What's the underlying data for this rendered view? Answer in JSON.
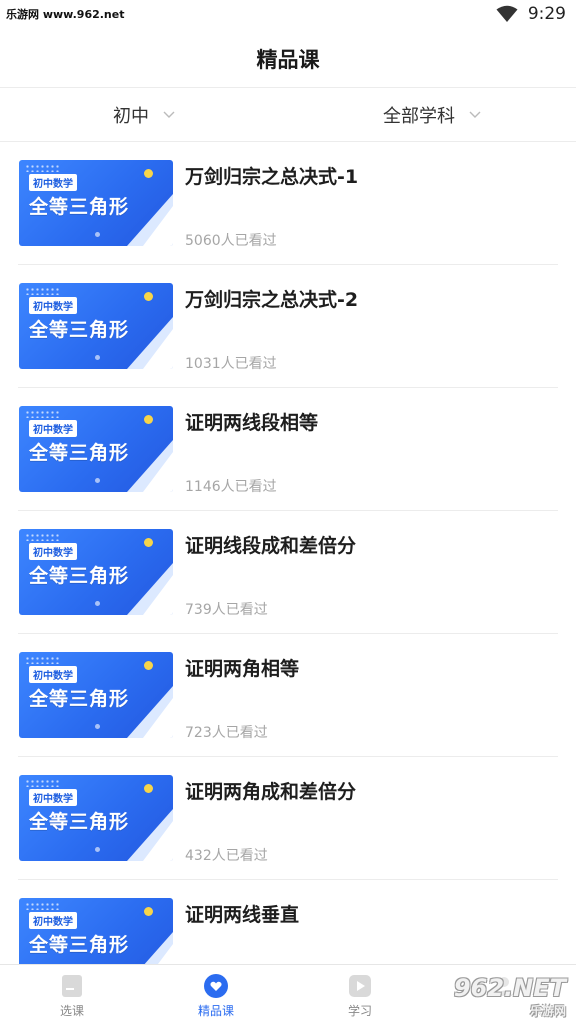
{
  "status_bar": {
    "watermark": "乐游网 www.962.net",
    "time": "9:29",
    "wifi_icon": "wifi-icon"
  },
  "header": {
    "title": "精品课"
  },
  "filters": [
    {
      "label": "初中",
      "icon": "chevron-down-icon"
    },
    {
      "label": "全部学科",
      "icon": "chevron-down-icon"
    }
  ],
  "thumbnail": {
    "tag": "初中数学",
    "text": "全等三角形"
  },
  "courses": [
    {
      "title": "万剑归宗之总决式-1",
      "views": "5060人已看过"
    },
    {
      "title": "万剑归宗之总决式-2",
      "views": "1031人已看过"
    },
    {
      "title": "证明两线段相等",
      "views": "1146人已看过"
    },
    {
      "title": "证明线段成和差倍分",
      "views": "739人已看过"
    },
    {
      "title": "证明两角相等",
      "views": "723人已看过"
    },
    {
      "title": "证明两角成和差倍分",
      "views": "432人已看过"
    },
    {
      "title": "证明两线垂直",
      "views": ""
    }
  ],
  "bottom_nav": [
    {
      "label": "选课",
      "icon": "course-select-icon",
      "active": false
    },
    {
      "label": "精品课",
      "icon": "heart-icon",
      "active": true
    },
    {
      "label": "学习",
      "icon": "play-icon",
      "active": false
    },
    {
      "label": "",
      "icon": "profile-icon",
      "active": false
    }
  ],
  "watermark_logo": {
    "number": "962.NET",
    "sub": "乐游网"
  },
  "colors": {
    "accent": "#2b6cf0",
    "thumb_blue": "#3d86ff",
    "muted_text": "#a6a6a6"
  }
}
